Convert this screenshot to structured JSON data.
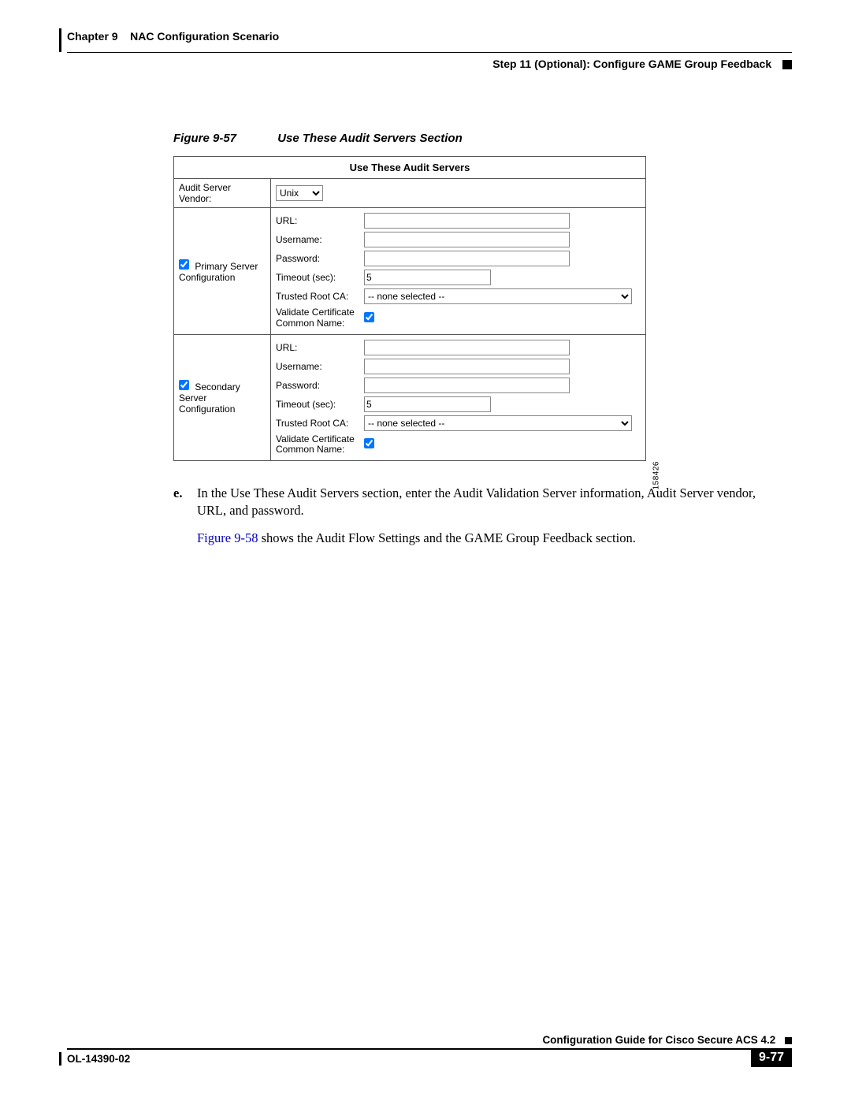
{
  "header": {
    "chapter": "Chapter 9    NAC Configuration Scenario",
    "section": "Step 11 (Optional): Configure GAME Group Feedback"
  },
  "figure": {
    "number": "Figure 9-57",
    "title": "Use These Audit Servers Section",
    "panel_title": "Use These Audit Servers",
    "side_id": "158426",
    "vendor": {
      "label": "Audit Server Vendor:",
      "selected": "Unix"
    },
    "primary": {
      "label": "Primary Server Configuration",
      "checked": true,
      "rows": {
        "url": {
          "label": "URL:",
          "value": ""
        },
        "user": {
          "label": "Username:",
          "value": ""
        },
        "pass": {
          "label": "Password:",
          "value": ""
        },
        "timeout": {
          "label": "Timeout (sec):",
          "value": "5"
        },
        "ca": {
          "label": "Trusted Root CA:",
          "selected": "-- none selected --"
        },
        "validate": {
          "label": "Validate Certificate Common Name:",
          "checked": true
        }
      }
    },
    "secondary": {
      "label": "Secondary Server Configuration",
      "checked": true,
      "rows": {
        "url": {
          "label": "URL:",
          "value": ""
        },
        "user": {
          "label": "Username:",
          "value": ""
        },
        "pass": {
          "label": "Password:",
          "value": ""
        },
        "timeout": {
          "label": "Timeout (sec):",
          "value": "5"
        },
        "ca": {
          "label": "Trusted Root CA:",
          "selected": "-- none selected --"
        },
        "validate": {
          "label": "Validate Certificate Common Name:",
          "checked": true
        }
      }
    }
  },
  "body": {
    "item_e_marker": "e.",
    "item_e_text": "In the Use These Audit Servers section, enter the Audit Validation Server information, Audit Server vendor, URL, and password.",
    "ref_link": "Figure 9-58",
    "ref_rest": " shows the Audit Flow Settings and the GAME Group Feedback section."
  },
  "footer": {
    "guide": "Configuration Guide for Cisco Secure ACS 4.2",
    "docnum": "OL-14390-02",
    "pagenum": "9-77"
  }
}
